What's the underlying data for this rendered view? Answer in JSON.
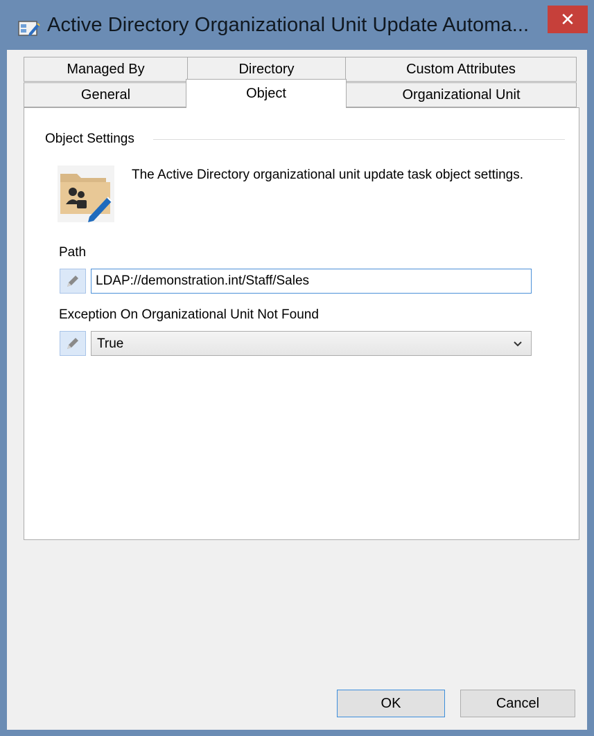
{
  "window": {
    "title": "Active Directory Organizational Unit Update Automa...",
    "close_glyph": "✕",
    "title_icon": "edit-window-icon"
  },
  "tabs": {
    "row1": [
      {
        "label": "Managed By"
      },
      {
        "label": "Directory"
      },
      {
        "label": "Custom Attributes"
      }
    ],
    "row2": [
      {
        "label": "General"
      },
      {
        "label": "Object",
        "selected": true
      },
      {
        "label": "Organizational Unit"
      }
    ]
  },
  "object_settings": {
    "group_label": "Object Settings",
    "icon": "folder-user-edit-icon",
    "description": "The Active Directory organizational unit update task object settings.",
    "path": {
      "label": "Path",
      "value": "LDAP://demonstration.int/Staff/Sales",
      "edit_icon": "pencil-icon"
    },
    "exception": {
      "label": "Exception On Organizational Unit Not Found",
      "value": "True",
      "edit_icon": "pencil-icon"
    }
  },
  "buttons": {
    "ok": "OK",
    "cancel": "Cancel"
  },
  "colors": {
    "titlebar": "#6b8cb4",
    "close": "#c6403a",
    "accent": "#3c8edc"
  }
}
